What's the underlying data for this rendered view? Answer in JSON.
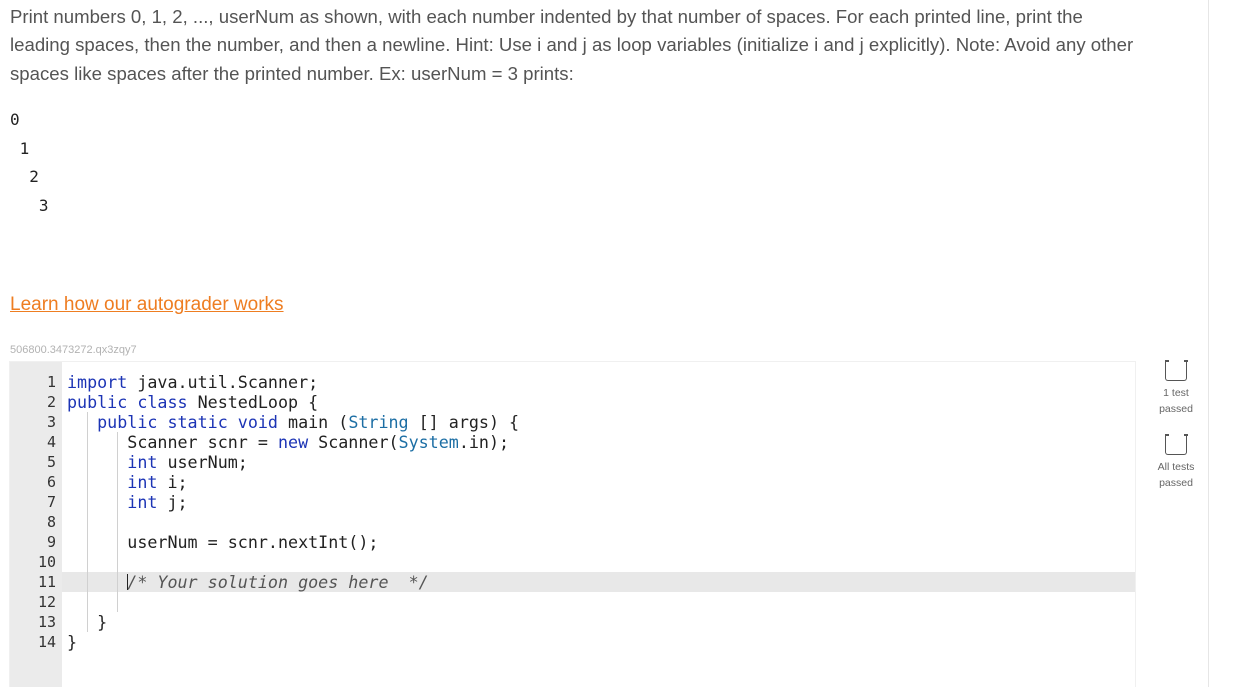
{
  "prompt": {
    "text": "Print numbers 0, 1, 2, ..., userNum as shown, with each number indented by that number of spaces. For each printed line, print the leading spaces, then the number, and then a newline. Hint: Use i and j as loop variables (initialize i and j explicitly). Note: Avoid any other spaces like spaces after the printed number. Ex: userNum = 3 prints:"
  },
  "example_output": [
    "0",
    " 1",
    "  2",
    "   3"
  ],
  "learn_link": "Learn how our autograder works",
  "challenge_id": "506800.3473272.qx3zqy7",
  "code": {
    "line_numbers": [
      "1",
      "2",
      "3",
      "4",
      "5",
      "6",
      "7",
      "8",
      "9",
      "10",
      "11",
      "12",
      "13",
      "14"
    ],
    "lines": [
      "import java.util.Scanner;",
      "public class NestedLoop {",
      "   public static void main (String [] args) {",
      "      Scanner scnr = new Scanner(System.in);",
      "      int userNum;",
      "      int i;",
      "      int j;",
      "",
      "      userNum = scnr.nextInt();",
      "",
      "      /* Your solution goes here  */",
      "",
      "   }",
      "}"
    ]
  },
  "status": {
    "test1": "1 test passed",
    "test2": "All tests passed"
  }
}
